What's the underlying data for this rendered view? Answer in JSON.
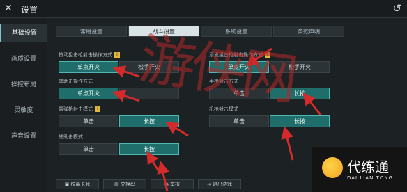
{
  "window": {
    "title": "设置"
  },
  "sidebar": {
    "items": [
      {
        "label": "基础设置",
        "active": true
      },
      {
        "label": "画质设置",
        "active": false
      },
      {
        "label": "操控布局",
        "active": false
      },
      {
        "label": "灵敏度",
        "active": false
      },
      {
        "label": "声音设置",
        "active": false
      }
    ]
  },
  "tabs": [
    {
      "label": "常用设置",
      "active": false
    },
    {
      "label": "战斗设置",
      "active": true
    },
    {
      "label": "系统设置",
      "active": false
    },
    {
      "label": "条款声明",
      "active": false
    }
  ],
  "settings": {
    "left_fire_mode": {
      "label": "按动狙击枪射击操作方式",
      "options": [
        "单点开火",
        "松手开火"
      ],
      "selected": 0
    },
    "right_fire_mode": {
      "label": "添发狙击枪射击操作方式",
      "options": [
        "单点开火",
        "松手开火"
      ],
      "selected": 0
    },
    "assist_fire": {
      "label": "辅助击操作方式",
      "options": [
        "单点开火",
        ""
      ],
      "selected": 0
    },
    "manual_fire": {
      "label": "手枪射击方式",
      "options": [
        "单击",
        "长按"
      ],
      "selected": 1
    },
    "sniper_scope_mode": {
      "label": "霰弹枪射击模式",
      "options": [
        "单击",
        "长按"
      ],
      "selected": 1
    },
    "right_scope_mode": {
      "label": "机枪射击模式",
      "options": [
        "单击",
        "长按"
      ],
      "selected": 1
    },
    "auxiliary_mode": {
      "label": "辅助击模式",
      "options": [
        "单击",
        "长按"
      ],
      "selected": 1
    }
  },
  "bottom_buttons": [
    {
      "label": "脱离卡死",
      "icon": "unstuck-icon"
    },
    {
      "label": "兑换码",
      "icon": "gift-icon"
    },
    {
      "label": "举报",
      "icon": "report-icon"
    },
    {
      "label": "退出游戏",
      "icon": "exit-icon"
    }
  ],
  "watermark": {
    "text": "游侠网"
  },
  "brand": {
    "name": "代练通",
    "subtitle": "DAI LIAN TONG"
  },
  "colors": {
    "accent": "#1f6e6b",
    "arrow": "#d32b2b",
    "brand_yellow": "#f0a21e"
  }
}
